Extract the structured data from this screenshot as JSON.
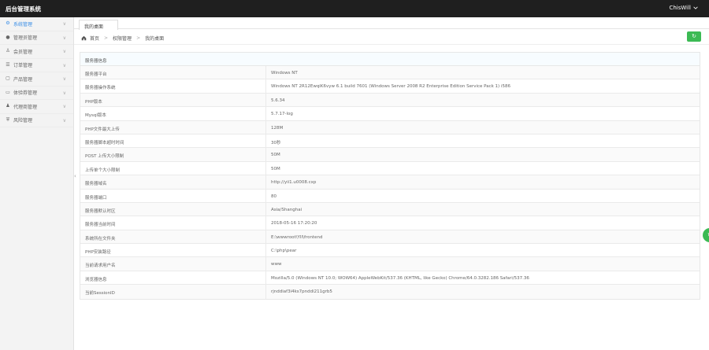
{
  "app_title": "后台管理系统",
  "user": {
    "name": "ChisWill"
  },
  "sidebar": {
    "items": [
      {
        "label": "系统管理",
        "icon": "gear-icon",
        "glyph": "⚙",
        "active": true
      },
      {
        "label": "管理员管理",
        "icon": "user-icon",
        "glyph": "●",
        "active": false
      },
      {
        "label": "会员管理",
        "icon": "person-icon",
        "glyph": "♙",
        "active": false
      },
      {
        "label": "订单管理",
        "icon": "list-icon",
        "glyph": "☰",
        "active": false
      },
      {
        "label": "产品管理",
        "icon": "box-icon",
        "glyph": "▢",
        "active": false
      },
      {
        "label": "体验券管理",
        "icon": "ticket-icon",
        "glyph": "▭",
        "active": false
      },
      {
        "label": "代理商管理",
        "icon": "agent-icon",
        "glyph": "♟",
        "active": false
      },
      {
        "label": "风险管理",
        "icon": "shield-icon",
        "glyph": "⛨",
        "active": false
      }
    ]
  },
  "tabs": [
    {
      "label": "我的桌面"
    }
  ],
  "breadcrumb": {
    "home": "首页",
    "level1": "权限管理",
    "level2": "我的桌面"
  },
  "panel": {
    "title": "服务器信息",
    "rows": [
      {
        "key": "服务器平台",
        "value": "Windows NT"
      },
      {
        "key": "服务器操作系统",
        "value": "Windows NT 2R12EwqiK6vyw 6.1 build 7601 (Windows Server 2008 R2 Enterprise Edition Service Pack 1) i586"
      },
      {
        "key": "PHP版本",
        "value": "5.6.34"
      },
      {
        "key": "Mysql版本",
        "value": "5.7.17-log"
      },
      {
        "key": "PHP文件最大上传",
        "value": "128M"
      },
      {
        "key": "服务器脚本超时时间",
        "value": "30秒"
      },
      {
        "key": "POST 上传大小限制",
        "value": "50M"
      },
      {
        "key": "上传单个大小限制",
        "value": "50M"
      },
      {
        "key": "服务器域名",
        "value": "http://yii1.u0008.cxp"
      },
      {
        "key": "服务器端口",
        "value": "80"
      },
      {
        "key": "服务器默认时区",
        "value": "Asia/Shanghai"
      },
      {
        "key": "服务器当前时间",
        "value": "2018-05-16 17:20:20"
      },
      {
        "key": "系统所在文件夹",
        "value": "E:\\wwwroot\\YII\\frontend"
      },
      {
        "key": "PHP安装路径",
        "value": "C:\\php\\pear"
      },
      {
        "key": "当前请求用户名",
        "value": "www"
      },
      {
        "key": "浏览器信息",
        "value": "Mozilla/5.0 (Windows NT 10.0; WOW64) AppleWebKit/537.36 (KHTML, like Gecko) Chrome/64.0.3282.186 Safari/537.36"
      },
      {
        "key": "当前SessionID",
        "value": "rjnddiaf3i4ks7pnddi211grb5"
      }
    ]
  },
  "colors": {
    "topbar": "#1f1f1f",
    "accent": "#3a8ee6",
    "green": "#3cba54"
  }
}
